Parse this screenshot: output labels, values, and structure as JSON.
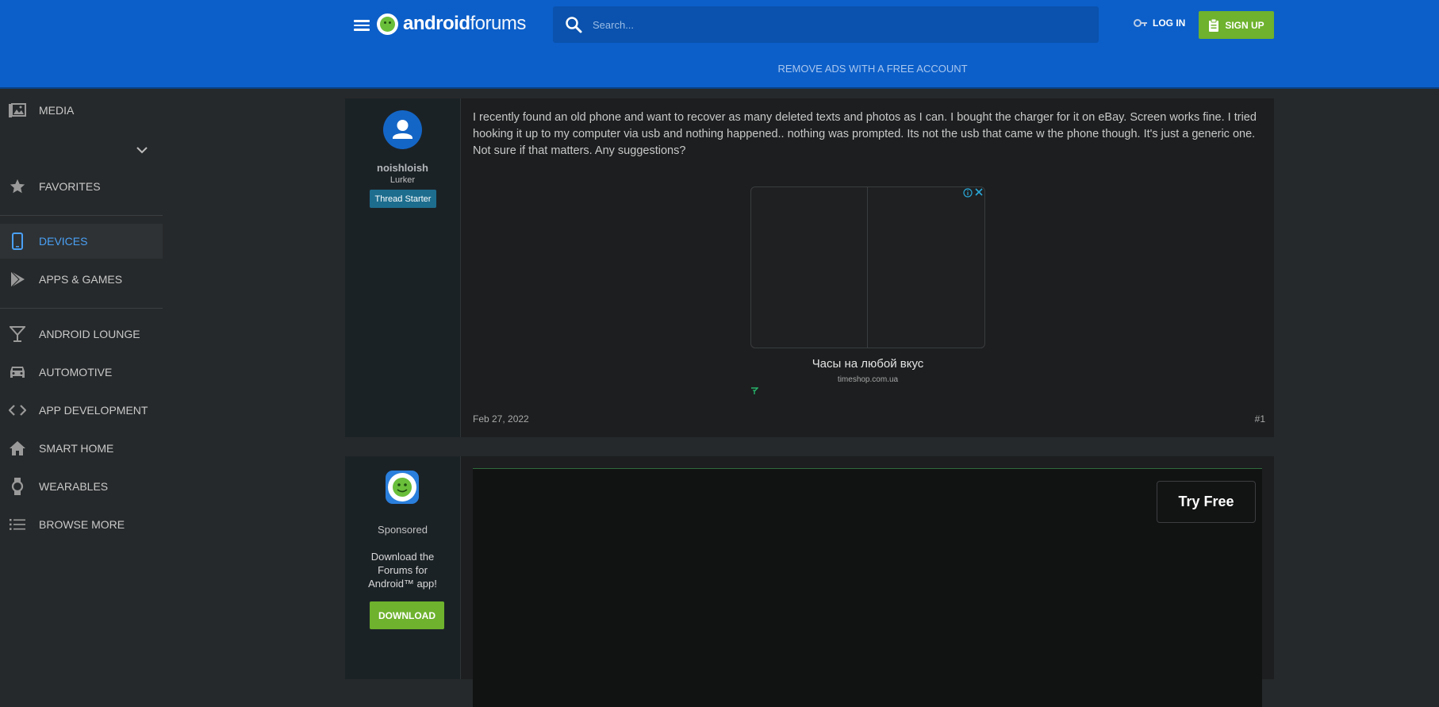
{
  "header": {
    "logo_bold": "android",
    "logo_light": "forums",
    "search_placeholder": "Search...",
    "login_label": "LOG IN",
    "signup_label": "SIGN UP",
    "remove_ads_label": "REMOVE ADS WITH A FREE ACCOUNT"
  },
  "sidebar": {
    "items": [
      {
        "label": "MEDIA",
        "icon": "media-icon"
      },
      {
        "label": "FAVORITES",
        "icon": "star-icon"
      },
      {
        "label": "DEVICES",
        "icon": "phone-icon",
        "active": true
      },
      {
        "label": "APPS & GAMES",
        "icon": "play-icon"
      },
      {
        "label": "ANDROID LOUNGE",
        "icon": "cocktail-icon"
      },
      {
        "label": "AUTOMOTIVE",
        "icon": "car-icon"
      },
      {
        "label": "APP DEVELOPMENT",
        "icon": "code-icon"
      },
      {
        "label": "SMART HOME",
        "icon": "home-icon"
      },
      {
        "label": "WEARABLES",
        "icon": "watch-icon"
      },
      {
        "label": "BROWSE MORE",
        "icon": "list-icon"
      }
    ]
  },
  "post1": {
    "username": "noishloish",
    "user_title": "Lurker",
    "badge": "Thread Starter",
    "body": "I recently found an old phone and want to recover as many deleted texts and photos as I can. I bought the charger for it on eBay. Screen works fine. I tried hooking it up to my computer via usb and nothing happened.. nothing was prompted. Its not the usb that came w the phone though. It's just a generic one. Not sure if that matters. Any suggestions?",
    "date": "Feb 27, 2022",
    "number": "#1",
    "ad": {
      "title": "Часы на любой вкус",
      "domain": "timeshop.com.ua"
    }
  },
  "post2": {
    "sponsored": "Sponsored",
    "download_text": "Download the Forums for Android™ app!",
    "download_button": "DOWNLOAD",
    "video_ad_button": "Try Free"
  },
  "colors": {
    "header_bg": "#0c5fc9",
    "accent_green": "#6eb22d",
    "active_nav": "#4aa0f5",
    "page_bg": "#26292b"
  }
}
